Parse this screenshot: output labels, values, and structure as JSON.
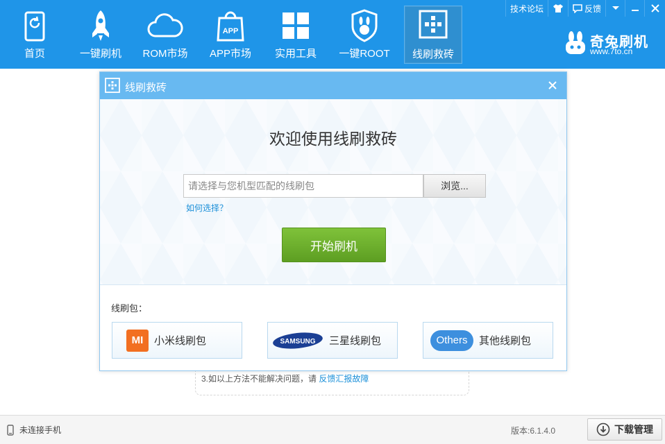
{
  "nav": {
    "items": [
      {
        "label": "首页",
        "icon": "home-icon"
      },
      {
        "label": "一键刷机",
        "icon": "rocket-icon"
      },
      {
        "label": "ROM市场",
        "icon": "cloud-icon"
      },
      {
        "label": "APP市场",
        "icon": "app-bag-icon",
        "icon_text": "APP"
      },
      {
        "label": "实用工具",
        "icon": "grid-icon"
      },
      {
        "label": "一键ROOT",
        "icon": "shield-rabbit-icon"
      },
      {
        "label": "线刷救砖",
        "icon": "flash-rescue-icon",
        "active": true
      }
    ]
  },
  "system": {
    "forum": "技术论坛",
    "feedback": "反馈"
  },
  "brand": {
    "name": "奇兔刷机",
    "url": "www.7to.cn"
  },
  "dialog": {
    "title": "线刷救砖",
    "welcome": "欢迎使用线刷救砖",
    "input_placeholder": "请选择与您机型匹配的线刷包",
    "browse": "浏览...",
    "howto": "如何选择？",
    "start": "开始刷机",
    "packages_label": "线刷包：",
    "packages": [
      {
        "logo_text": "MI",
        "label": "小米线刷包"
      },
      {
        "logo_text": "SAMSUNG",
        "label": "三星线刷包"
      },
      {
        "logo_text": "Others",
        "label": "其他线刷包"
      }
    ]
  },
  "background": {
    "tip_text": "3.如以上方法不能解决问题，请",
    "tip_link": "反馈汇报故障"
  },
  "status": {
    "connection": "未连接手机",
    "version": "版本:6.1.4.0",
    "download_manager": "下载管理"
  },
  "colors": {
    "topbar": "#1f95e8",
    "dialog_header": "#68b9f1",
    "start_button": "#6aad2b",
    "link": "#1a8fd8",
    "mi_orange": "#f26f21"
  }
}
